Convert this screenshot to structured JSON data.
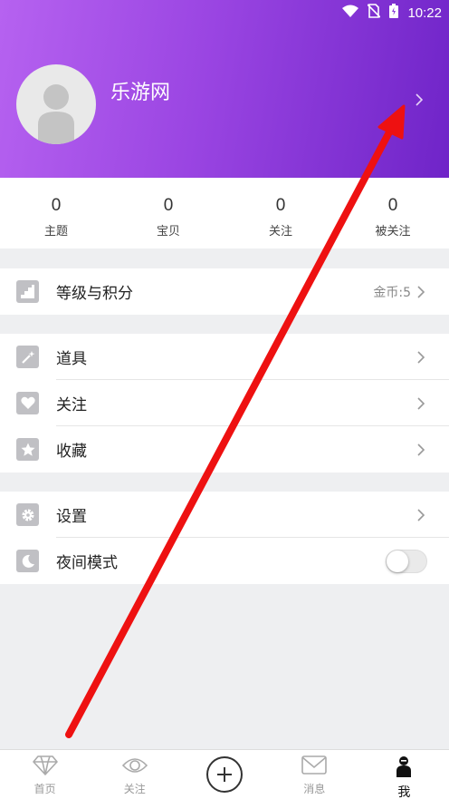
{
  "status_bar": {
    "time": "10:22"
  },
  "profile": {
    "username": "乐游网"
  },
  "stats": [
    {
      "value": "0",
      "label": "主题"
    },
    {
      "value": "0",
      "label": "宝贝"
    },
    {
      "value": "0",
      "label": "关注"
    },
    {
      "value": "0",
      "label": "被关注"
    }
  ],
  "level_row": {
    "label": "等级与积分",
    "value": "金币:5"
  },
  "menu_group": [
    {
      "label": "道具"
    },
    {
      "label": "关注"
    },
    {
      "label": "收藏"
    }
  ],
  "settings_group": {
    "settings_label": "设置",
    "night_mode_label": "夜间模式",
    "night_mode_on": false
  },
  "tabbar": [
    {
      "label": "首页",
      "icon": "diamond-icon"
    },
    {
      "label": "关注",
      "icon": "eye-icon"
    },
    {
      "label": "",
      "icon": "plus-icon"
    },
    {
      "label": "消息",
      "icon": "mail-icon"
    },
    {
      "label": "我",
      "icon": "person-icon",
      "active": true
    }
  ],
  "annotation": {
    "color": "#ee1111",
    "type": "red-arrow"
  }
}
